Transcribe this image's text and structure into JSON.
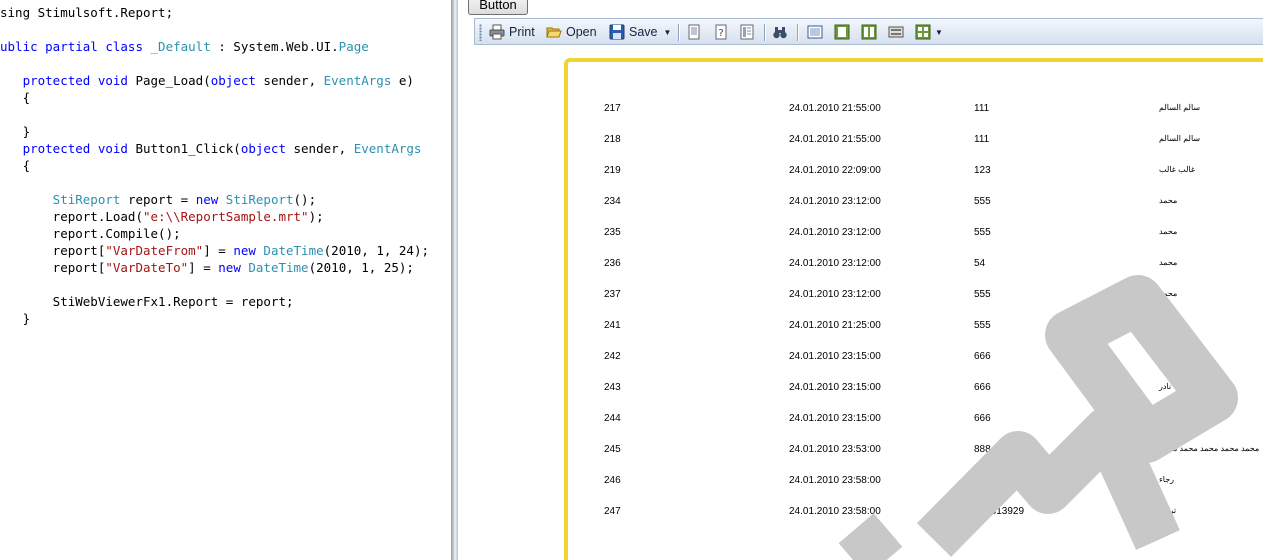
{
  "code": {
    "lines": [
      {
        "segs": [
          {
            "t": "sing Stimulsoft.Report;",
            "c": ""
          }
        ]
      },
      {
        "segs": []
      },
      {
        "segs": [
          {
            "t": "ublic partial class ",
            "c": "kw"
          },
          {
            "t": "_Default",
            "c": "ty"
          },
          {
            "t": " : System.Web.UI.",
            "c": ""
          },
          {
            "t": "Page",
            "c": "ty"
          }
        ]
      },
      {
        "segs": []
      },
      {
        "segs": [
          {
            "t": "   protected void",
            "c": "kw"
          },
          {
            "t": " Page_Load(",
            "c": ""
          },
          {
            "t": "object",
            "c": "kw"
          },
          {
            "t": " sender, ",
            "c": ""
          },
          {
            "t": "EventArgs",
            "c": "ty"
          },
          {
            "t": " e)",
            "c": ""
          }
        ]
      },
      {
        "segs": [
          {
            "t": "   {",
            "c": ""
          }
        ]
      },
      {
        "segs": []
      },
      {
        "segs": [
          {
            "t": "   }",
            "c": ""
          }
        ]
      },
      {
        "segs": [
          {
            "t": "   protected void",
            "c": "kw"
          },
          {
            "t": " Button1_Click(",
            "c": ""
          },
          {
            "t": "object",
            "c": "kw"
          },
          {
            "t": " sender, ",
            "c": ""
          },
          {
            "t": "EventArgs",
            "c": "ty"
          }
        ]
      },
      {
        "segs": [
          {
            "t": "   {",
            "c": ""
          }
        ]
      },
      {
        "segs": []
      },
      {
        "segs": [
          {
            "t": "       StiReport",
            "c": "ty"
          },
          {
            "t": " report = ",
            "c": ""
          },
          {
            "t": "new",
            "c": "kw"
          },
          {
            "t": " ",
            "c": ""
          },
          {
            "t": "StiReport",
            "c": "ty"
          },
          {
            "t": "();",
            "c": ""
          }
        ]
      },
      {
        "segs": [
          {
            "t": "       report.Load(",
            "c": ""
          },
          {
            "t": "\"e:\\\\ReportSample.mrt\"",
            "c": "st"
          },
          {
            "t": ");",
            "c": ""
          }
        ]
      },
      {
        "segs": [
          {
            "t": "       report.Compile();",
            "c": ""
          }
        ]
      },
      {
        "segs": [
          {
            "t": "       report[",
            "c": ""
          },
          {
            "t": "\"VarDateFrom\"",
            "c": "st"
          },
          {
            "t": "] = ",
            "c": ""
          },
          {
            "t": "new",
            "c": "kw"
          },
          {
            "t": " ",
            "c": ""
          },
          {
            "t": "DateTime",
            "c": "ty"
          },
          {
            "t": "(2010, 1, 24);",
            "c": ""
          }
        ]
      },
      {
        "segs": [
          {
            "t": "       report[",
            "c": ""
          },
          {
            "t": "\"VarDateTo\"",
            "c": "st"
          },
          {
            "t": "] = ",
            "c": ""
          },
          {
            "t": "new",
            "c": "kw"
          },
          {
            "t": " ",
            "c": ""
          },
          {
            "t": "DateTime",
            "c": "ty"
          },
          {
            "t": "(2010, 1, 25);",
            "c": ""
          }
        ]
      },
      {
        "segs": []
      },
      {
        "segs": [
          {
            "t": "       StiWebViewerFx1.Report = report;",
            "c": ""
          }
        ]
      },
      {
        "segs": [
          {
            "t": "   }",
            "c": ""
          }
        ]
      }
    ]
  },
  "top_button": {
    "label": "Button"
  },
  "toolbar": {
    "print_label": "Print",
    "open_label": "Open",
    "save_label": "Save"
  },
  "report": {
    "rows": [
      {
        "id": "217",
        "date": "24.01.2010 21:55:00",
        "num": "111",
        "name": "سالم السالم"
      },
      {
        "id": "218",
        "date": "24.01.2010 21:55:00",
        "num": "111",
        "name": "سالم السالم"
      },
      {
        "id": "219",
        "date": "24.01.2010 22:09:00",
        "num": "123",
        "name": "غالب غالب"
      },
      {
        "id": "234",
        "date": "24.01.2010 23:12:00",
        "num": "555",
        "name": "محمد"
      },
      {
        "id": "235",
        "date": "24.01.2010 23:12:00",
        "num": "555",
        "name": "محمد"
      },
      {
        "id": "236",
        "date": "24.01.2010 23:12:00",
        "num": "54",
        "name": "محمد"
      },
      {
        "id": "237",
        "date": "24.01.2010 23:12:00",
        "num": "555",
        "name": "محمد"
      },
      {
        "id": "241",
        "date": "24.01.2010 21:25:00",
        "num": "555",
        "name": "محمد"
      },
      {
        "id": "242",
        "date": "24.01.2010 23:15:00",
        "num": "666",
        "name": "نادر"
      },
      {
        "id": "243",
        "date": "24.01.2010 23:15:00",
        "num": "666",
        "name": "نادر"
      },
      {
        "id": "244",
        "date": "24.01.2010 23:15:00",
        "num": "666",
        "name": "نادر"
      },
      {
        "id": "245",
        "date": "24.01.2010 23:53:00",
        "num": "888",
        "name": "محمد محمد محمد محمد محمد"
      },
      {
        "id": "246",
        "date": "24.01.2010 23:58:00",
        "num": "424830025",
        "name": "رجاء"
      },
      {
        "id": "247",
        "date": "24.01.2010 23:58:00",
        "num": "431813929",
        "name": "تركية"
      }
    ]
  },
  "colors": {
    "page_border": "#f2d430",
    "watermark": "#c8c8c8",
    "keyword": "#0000ff",
    "type": "#2b91af",
    "string": "#a31515"
  },
  "watermark": {
    "icon": "demo-watermark"
  }
}
